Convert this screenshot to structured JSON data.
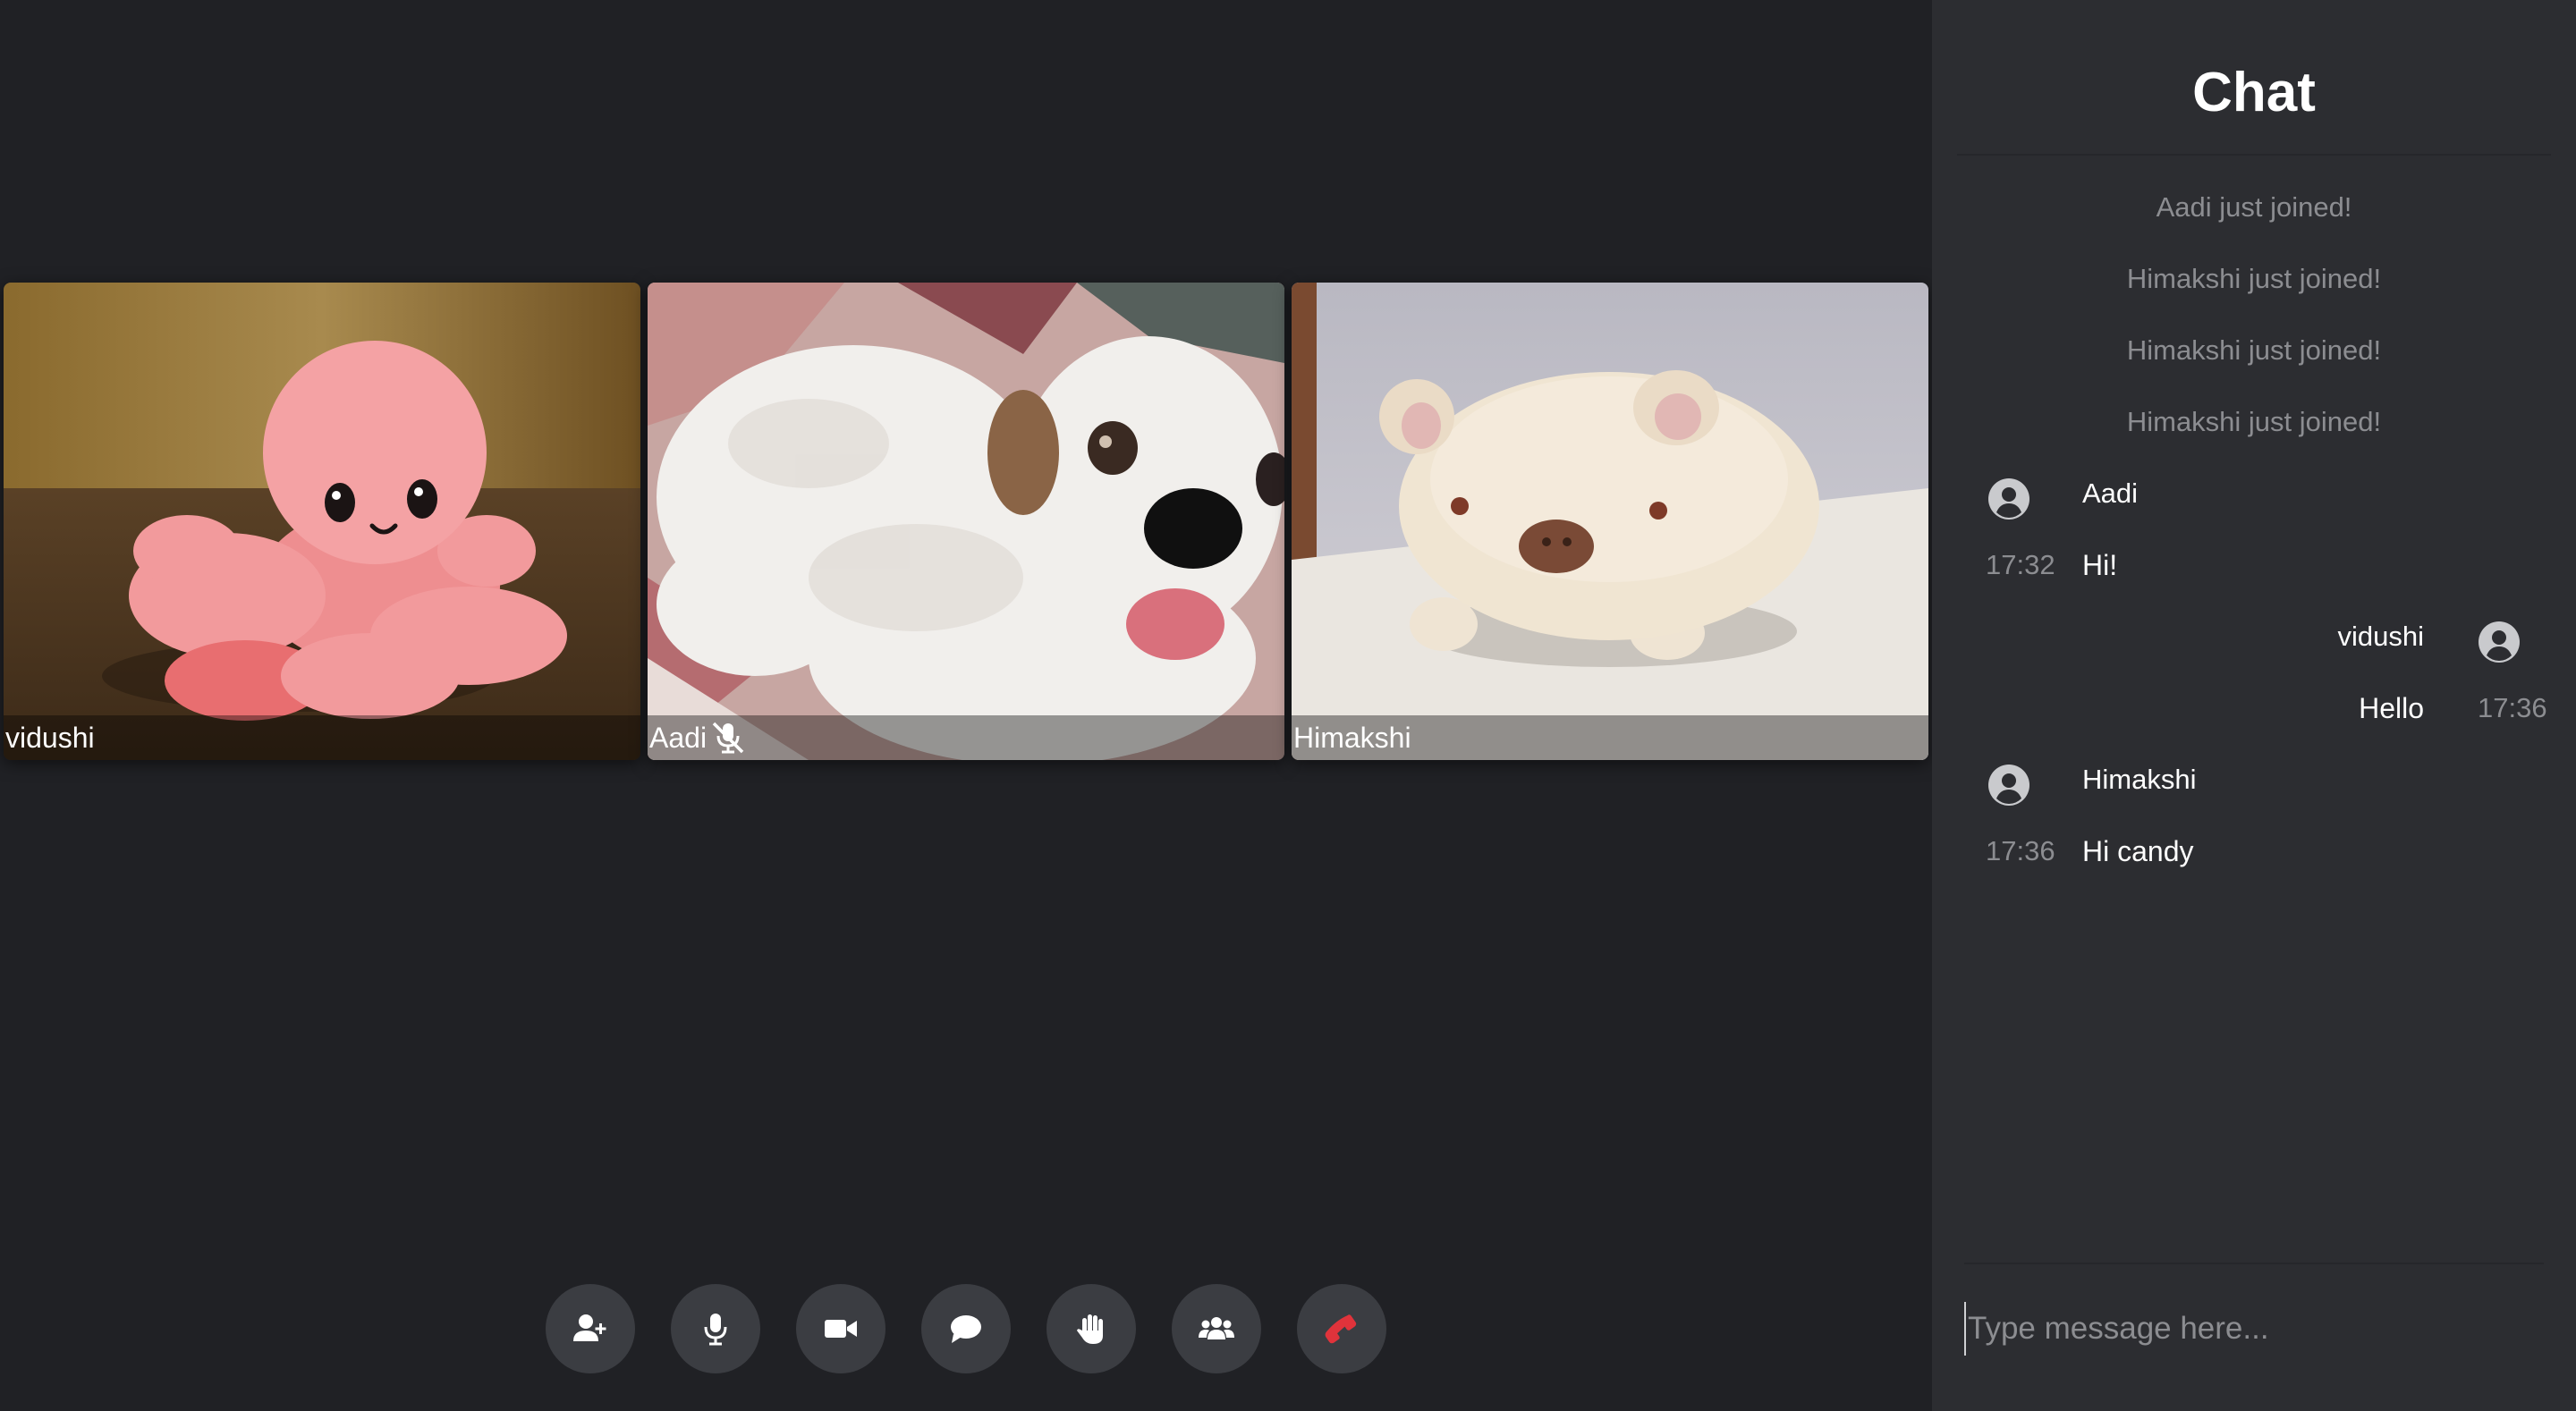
{
  "participants": [
    {
      "name": "vidushi",
      "muted": false
    },
    {
      "name": "Aadi",
      "muted": true
    },
    {
      "name": "Himakshi",
      "muted": false
    }
  ],
  "controls": [
    {
      "icon": "add-user-icon",
      "action": "invite"
    },
    {
      "icon": "microphone-icon",
      "action": "mute"
    },
    {
      "icon": "video-camera-icon",
      "action": "camera"
    },
    {
      "icon": "chat-bubble-icon",
      "action": "chat"
    },
    {
      "icon": "raise-hand-icon",
      "action": "raise-hand"
    },
    {
      "icon": "participants-icon",
      "action": "participants"
    },
    {
      "icon": "end-call-icon",
      "action": "hang-up"
    }
  ],
  "chat": {
    "title": "Chat",
    "system_messages": [
      "Aadi just joined!",
      "Himakshi just joined!",
      "Himakshi just joined!",
      "Himakshi just joined!"
    ],
    "messages": [
      {
        "user": "Aadi",
        "time": "17:32",
        "text": "Hi!",
        "self": false
      },
      {
        "user": "vidushi",
        "time": "17:36",
        "text": "Hello",
        "self": true
      },
      {
        "user": "Himakshi",
        "time": "17:36",
        "text": "Hi candy",
        "self": false
      }
    ],
    "input_placeholder": "Type message here..."
  },
  "colors": {
    "stage_bg": "#202125",
    "panel_bg": "#2c2d31",
    "control_bg": "#3b3d42",
    "muted_text": "#8c8d91",
    "hangup_red": "#e0333b"
  }
}
